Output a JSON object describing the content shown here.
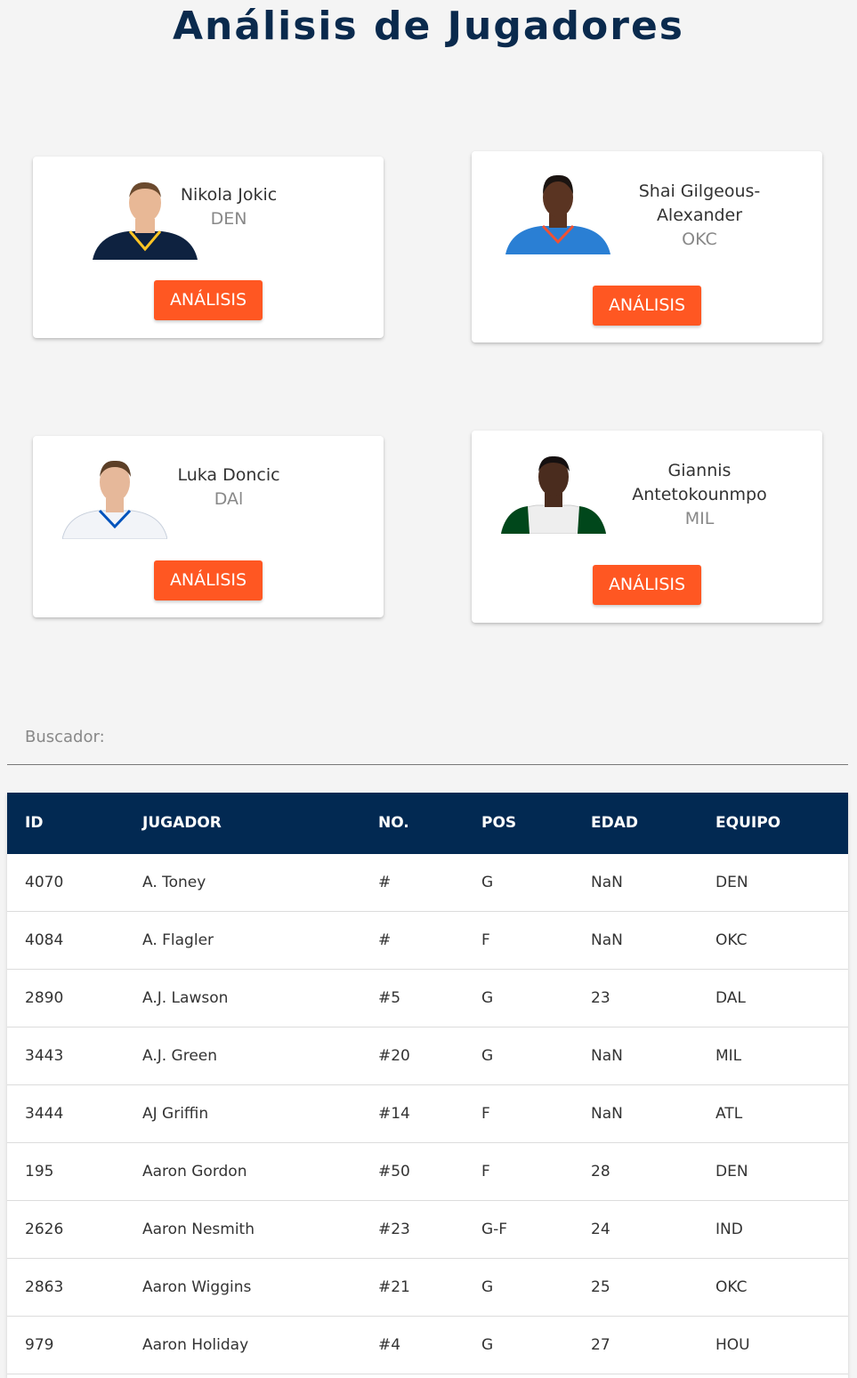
{
  "page": {
    "title": "Análisis de Jugadores"
  },
  "cards": [
    {
      "name_lines": [
        "Nikola Jokic"
      ],
      "team": "DEN",
      "button": "ANÁLISIS",
      "jersey_color": "#0e2240",
      "skin": "#e8b896",
      "hair": "#6b4a2e"
    },
    {
      "name_lines": [
        "Shai Gilgeous-",
        "Alexander"
      ],
      "team": "OKC",
      "button": "ANÁLISIS",
      "jersey_color": "#2a7fd4",
      "skin": "#5a3422",
      "hair": "#1b1411"
    },
    {
      "name_lines": [
        "Luka Doncic"
      ],
      "team": "DAl",
      "button": "ANÁLISIS",
      "jersey_color": "#f2f4f8",
      "skin": "#e6b89a",
      "hair": "#5c3f27"
    },
    {
      "name_lines": [
        "Giannis",
        "Antetokounmpo"
      ],
      "team": "MIL",
      "button": "ANÁLISIS",
      "jersey_color": "#eeeeee",
      "skin": "#4a2c1e",
      "hair": "#151010"
    }
  ],
  "search": {
    "label": "Buscador:",
    "value": ""
  },
  "table": {
    "headers": [
      "ID",
      "JUGADOR",
      "NO.",
      "POS",
      "EDAD",
      "EQUIPO"
    ],
    "rows": [
      [
        "4070",
        "A. Toney",
        "#",
        "G",
        "NaN",
        "DEN"
      ],
      [
        "4084",
        "A. Flagler",
        "#",
        "F",
        "NaN",
        "OKC"
      ],
      [
        "2890",
        "A.J. Lawson",
        "#5",
        "G",
        "23",
        "DAL"
      ],
      [
        "3443",
        "A.J. Green",
        "#20",
        "G",
        "NaN",
        "MIL"
      ],
      [
        "3444",
        "AJ Griffin",
        "#14",
        "F",
        "NaN",
        "ATL"
      ],
      [
        "195",
        "Aaron Gordon",
        "#50",
        "F",
        "28",
        "DEN"
      ],
      [
        "2626",
        "Aaron Nesmith",
        "#23",
        "G-F",
        "24",
        "IND"
      ],
      [
        "2863",
        "Aaron Wiggins",
        "#21",
        "G",
        "25",
        "OKC"
      ],
      [
        "979",
        "Aaron Holiday",
        "#4",
        "G",
        "27",
        "HOU"
      ]
    ]
  },
  "colors": {
    "header_bg": "#022952",
    "button_bg": "#ff5722",
    "title": "#0a2a4d"
  }
}
